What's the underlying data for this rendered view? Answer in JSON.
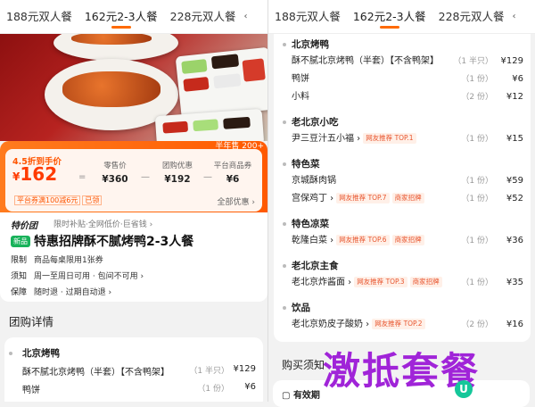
{
  "left": {
    "tabs": [
      {
        "label": "188元双人餐",
        "active": false
      },
      {
        "label": "162元2-3人餐",
        "active": true
      },
      {
        "label": "228元双人餐",
        "active": false
      }
    ],
    "tab_more": "‹",
    "hero_label": "半年售 200+",
    "price": {
      "discount": "4.5折到手价",
      "currency": "¥",
      "amount": "162",
      "op_eq": "=",
      "op_minus1": "—",
      "op_minus2": "—",
      "retail_label": "零售价",
      "retail_value": "¥360",
      "group_label": "团购优惠",
      "group_value": "¥192",
      "platform_label": "平台商品券",
      "platform_value": "¥6",
      "coupon_text": "平台券满100减6元",
      "coupon_status": "已领",
      "all_coupon": "全部优惠 ›"
    },
    "deal": {
      "brand": "特价团",
      "brand_sub": "限时补贴·全网低价·巨省钱 ›",
      "new_badge": "新品",
      "title": "特惠招牌酥不腻烤鸭2-3人餐",
      "rows": [
        {
          "key": "限制",
          "value": "商品每桌限用1张券"
        },
        {
          "key": "须知",
          "value": "周一至周日可用 · 包间不可用 ›"
        },
        {
          "key": "保障",
          "value": "随时退 · 过期自动退 ›"
        }
      ]
    },
    "section_title": "团购详情",
    "detail": {
      "group_title": "北京烤鸭",
      "items": [
        {
          "name": "酥不腻北京烤鸭（半套）【不含鸭架】",
          "qty": "（1 半只）",
          "price": "¥129"
        },
        {
          "name": "鸭饼",
          "qty": "（1 份）",
          "price": "¥6"
        }
      ]
    }
  },
  "right": {
    "tabs": [
      {
        "label": "188元双人餐",
        "active": false
      },
      {
        "label": "162元2-3人餐",
        "active": true
      },
      {
        "label": "228元双人餐",
        "active": false
      }
    ],
    "tab_more": "‹",
    "groups": [
      {
        "title": "北京烤鸭",
        "items": [
          {
            "name": "酥不腻北京烤鸭（半套）【不含鸭架】",
            "qty": "（1 半只）",
            "price": "¥129",
            "tags": []
          },
          {
            "name": "鸭饼",
            "qty": "（1 份）",
            "price": "¥6",
            "tags": []
          },
          {
            "name": "小料",
            "qty": "（2 份）",
            "price": "¥12",
            "tags": []
          }
        ]
      },
      {
        "title": "老北京小吃",
        "items": [
          {
            "name": "尹三豆汁五小福 ›",
            "qty": "（1 份）",
            "price": "¥15",
            "tags": [
              "网友推荐 TOP.1"
            ]
          }
        ]
      },
      {
        "title": "特色菜",
        "items": [
          {
            "name": "京城酥肉锅",
            "qty": "（1 份）",
            "price": "¥59",
            "tags": []
          },
          {
            "name": "宫保鸡丁 ›",
            "qty": "（1 份）",
            "price": "¥52",
            "tags": [
              "网友推荐 TOP.7",
              "商家招牌"
            ]
          }
        ]
      },
      {
        "title": "特色凉菜",
        "items": [
          {
            "name": "乾隆白菜 ›",
            "qty": "（1 份）",
            "price": "¥36",
            "tags": [
              "网友推荐 TOP.6",
              "商家招牌"
            ]
          }
        ]
      },
      {
        "title": "老北京主食",
        "items": [
          {
            "name": "老北京炸酱面 ›",
            "qty": "（1 份）",
            "price": "¥35",
            "tags": [
              "网友推荐 TOP.3",
              "商家招牌"
            ]
          }
        ]
      },
      {
        "title": "饮品",
        "items": [
          {
            "name": "老北京奶皮子酸奶 ›",
            "qty": "（2 份）",
            "price": "¥16",
            "tags": [
              "网友推荐 TOP.2"
            ]
          }
        ]
      }
    ],
    "notice_title": "购买须知",
    "valid_title": "有效期"
  },
  "watermark": "激抵套餐",
  "watermark_icon": "U",
  "colors": {
    "accent": "#ff5a00",
    "new_badge": "#18b25a",
    "watermark": "#a024d8"
  }
}
